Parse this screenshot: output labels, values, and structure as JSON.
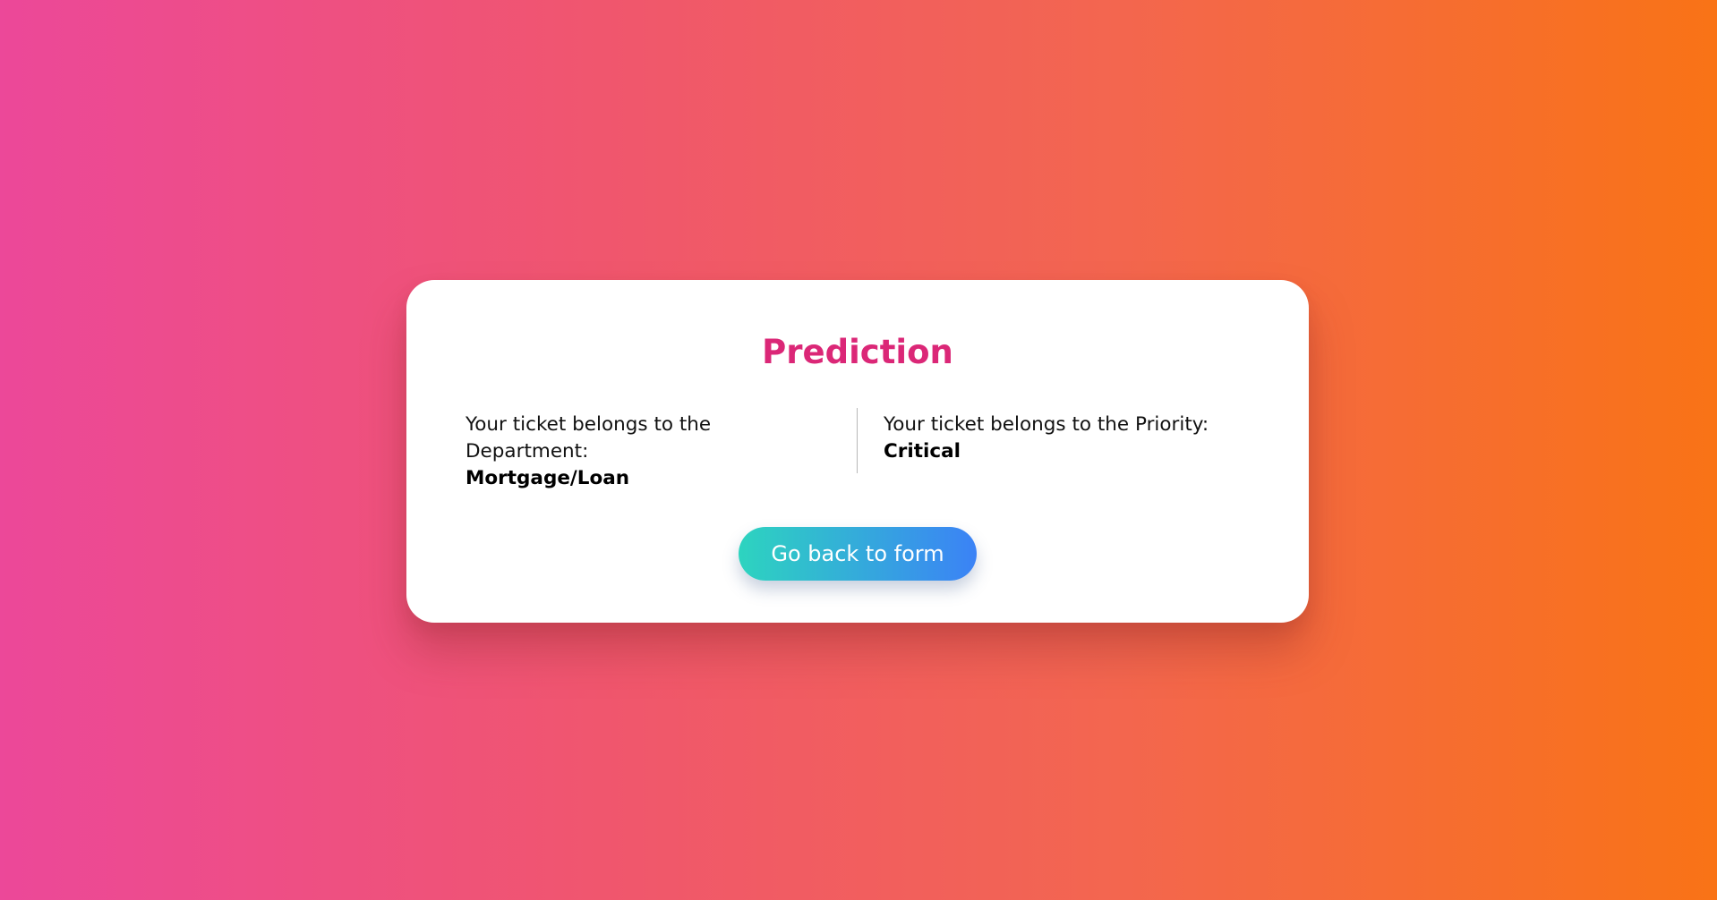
{
  "card": {
    "title": "Prediction",
    "department": {
      "label": "Your ticket belongs to the Department:",
      "value": "Mortgage/Loan"
    },
    "priority": {
      "label": "Your ticket belongs to the Priority:",
      "value": "Critical"
    },
    "back_button_label": "Go back to form"
  },
  "colors": {
    "background_start": "#ec4899",
    "background_end": "#f97316",
    "title": "#db2777",
    "button_start": "#2dd4bf",
    "button_end": "#3b82f6"
  }
}
